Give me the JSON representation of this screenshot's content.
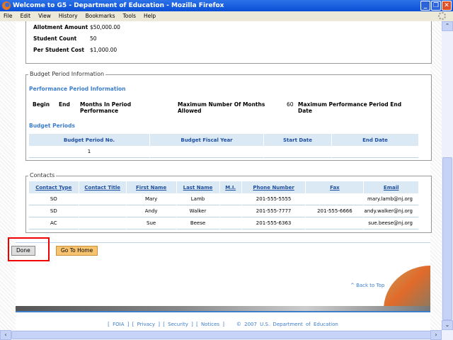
{
  "window": {
    "title": "Welcome to G5 - Department of Education - Mozilla Firefox"
  },
  "menu": [
    "File",
    "Edit",
    "View",
    "History",
    "Bookmarks",
    "Tools",
    "Help"
  ],
  "allotment": [
    {
      "label": "Allotment Amount",
      "value": "$50,000.00"
    },
    {
      "label": "Student Count",
      "value": "50"
    },
    {
      "label": "Per Student Cost",
      "value": "$1,000.00"
    }
  ],
  "budget": {
    "legend": "Budget Period Information",
    "perf_title": "Performance Period Information",
    "begin": "Begin",
    "end": "End",
    "months": "Months In Period Performance",
    "max_months": "Maximum Number Of Months Allowed",
    "max_months_value": "60",
    "max_end": "Maximum Performance Period End Date",
    "periods_title": "Budget Periods",
    "headers": [
      "Budget Period No.",
      "Budget Fiscal Year",
      "Start Date",
      "End Date"
    ],
    "rows": [
      [
        "1",
        "",
        "",
        ""
      ]
    ]
  },
  "contacts": {
    "legend": "Contacts",
    "headers": [
      "Contact Type",
      "Contact Title",
      "First Name",
      "Last Name",
      "M.I.",
      "Phone Number",
      "Fax",
      "Email"
    ],
    "rows": [
      [
        "SO",
        "",
        "Mary",
        "Lamb",
        "",
        "201-555-5555",
        "",
        "mary.lamb@nj.org"
      ],
      [
        "SD",
        "",
        "Andy",
        "Walker",
        "",
        "201-555-7777",
        "201-555-6666",
        "andy.walker@nj.org"
      ],
      [
        "AC",
        "",
        "Sue",
        "Beese",
        "",
        "201-555-6363",
        "",
        "sue.beese@nj.org"
      ]
    ]
  },
  "buttons": {
    "done": "Done",
    "home": "Go To Home"
  },
  "back_to_top": "^ Back to Top",
  "footer": {
    "links": [
      "FOIA",
      "Privacy",
      "Security",
      "Notices"
    ],
    "copyright": "© 2007 U.S. Department of Education"
  }
}
